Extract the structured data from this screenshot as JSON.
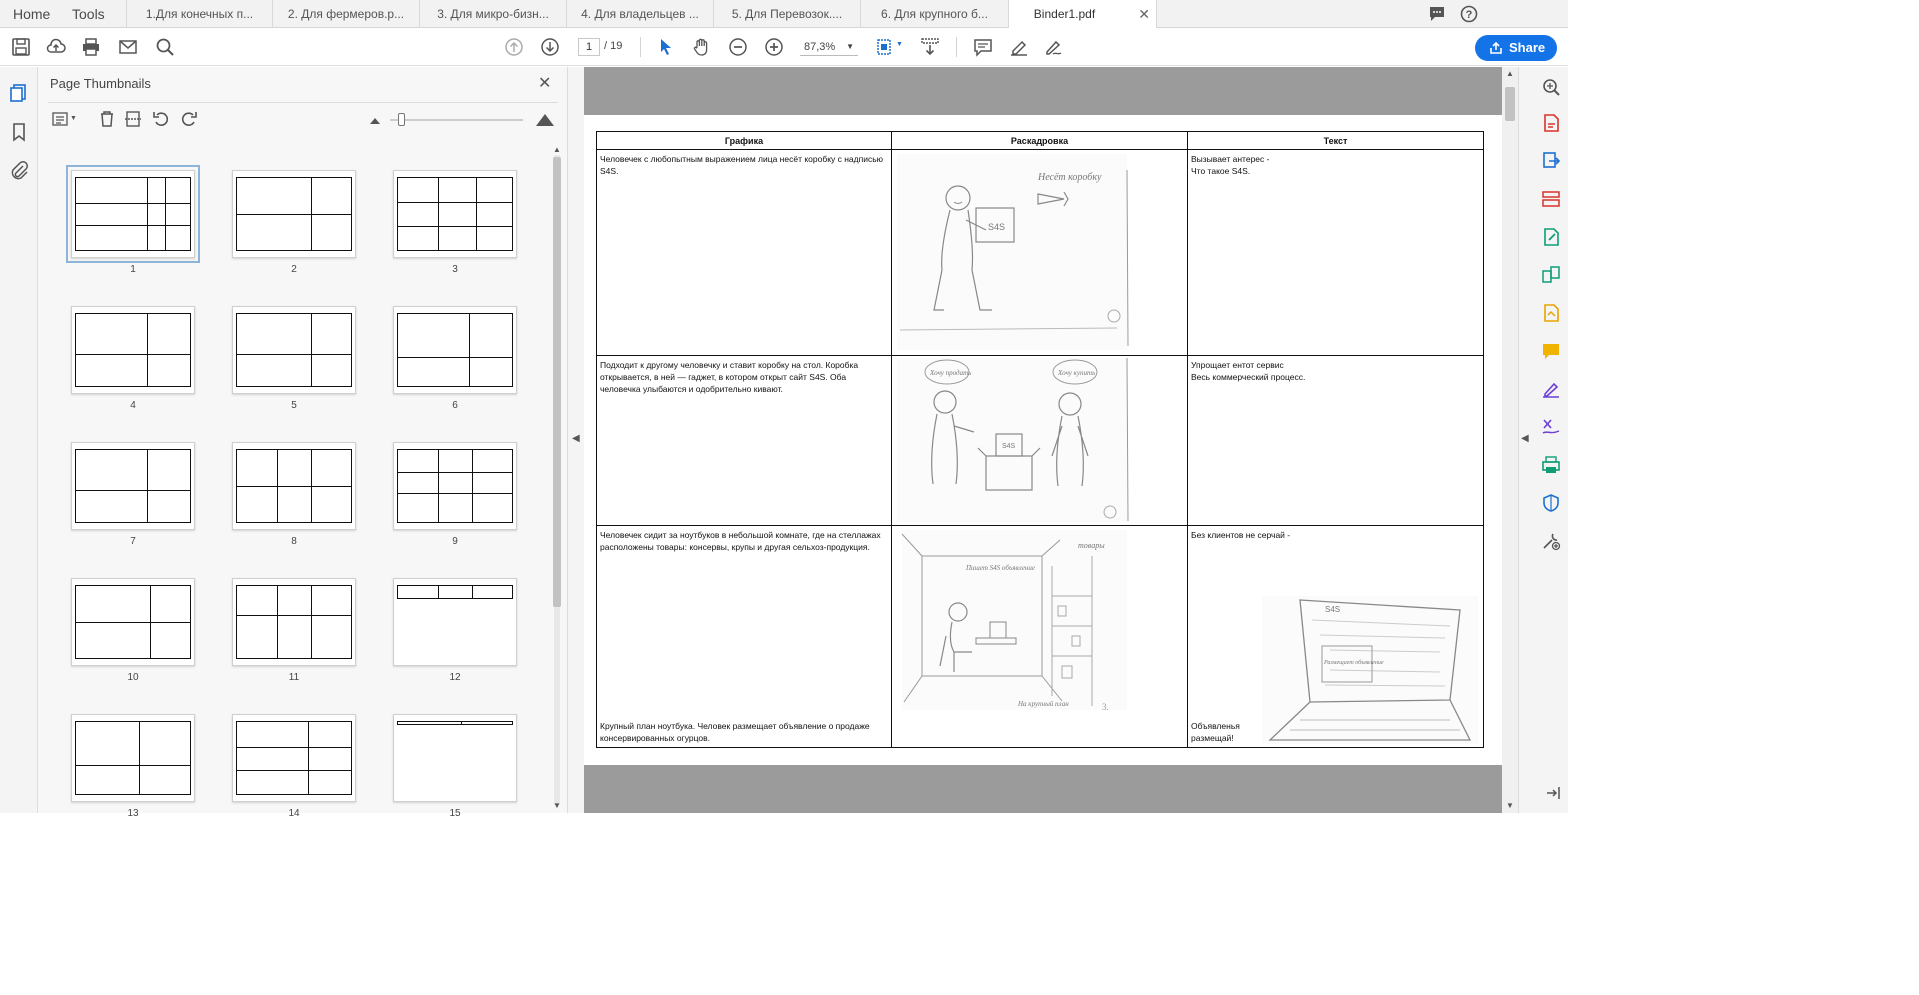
{
  "nav": {
    "home": "Home",
    "tools": "Tools"
  },
  "tabs": [
    {
      "label": "1.Для конечных п..."
    },
    {
      "label": "2. Для фермеров.р..."
    },
    {
      "label": "3. Для микро-бизн..."
    },
    {
      "label": "4. Для владельцев ..."
    },
    {
      "label": "5. Для Перевозок...."
    },
    {
      "label": "6. Для крупного б..."
    },
    {
      "label": "Binder1.pdf",
      "active": true
    }
  ],
  "toolbar": {
    "page_current": "1",
    "page_total": "/ 19",
    "zoom": "87,3%",
    "share_label": "Share"
  },
  "thumbnails": {
    "title": "Page Thumbnails",
    "pages": [
      "1",
      "2",
      "3",
      "4",
      "5",
      "6",
      "7",
      "8",
      "9",
      "10",
      "11",
      "12",
      "13",
      "14",
      "15"
    ]
  },
  "document": {
    "headers": [
      "Графика",
      "Раскадровка",
      "Текст"
    ],
    "rows": [
      {
        "graphics": "Человечек с любопытным выражением лица несёт коробку с надписью S4S.",
        "sketch_labels": [
          "Несёт коробку",
          "S4S"
        ],
        "text_lines": [
          "Вызывает антерес -",
          "Что такое S4S."
        ]
      },
      {
        "graphics": "Подходит к другому человечку и ставит коробку на стол. Коробка открывается, в ней — гаджет, в котором открыт сайт S4S. Оба человечка улыбаются и одобрительно кивают.",
        "sketch_labels": [
          "Хочу продать",
          "Хочу купить",
          "S4S"
        ],
        "text_lines": [
          "Упрощает ентот сервис",
          "Весь коммерческий процесс."
        ]
      },
      {
        "graphics": "Человечек сидит за ноутбуков в небольшой комнате, где на стеллажах расположены товары: консервы, крупы и другая сельхоз-продукция.",
        "graphics_bottom": "Крупный план ноутбука. Человек размещает объявление о продаже консервированных огурцов.",
        "sketch_labels": [
          "товары",
          "Пишет S4S объявление",
          "На крупный план"
        ],
        "text_lines": [
          "Без клиентов не серчай -"
        ],
        "text_bottom": [
          "Объявленья",
          "размещай!"
        ],
        "sketch2_labels": [
          "S4S",
          "Размещает объявление"
        ]
      }
    ]
  }
}
